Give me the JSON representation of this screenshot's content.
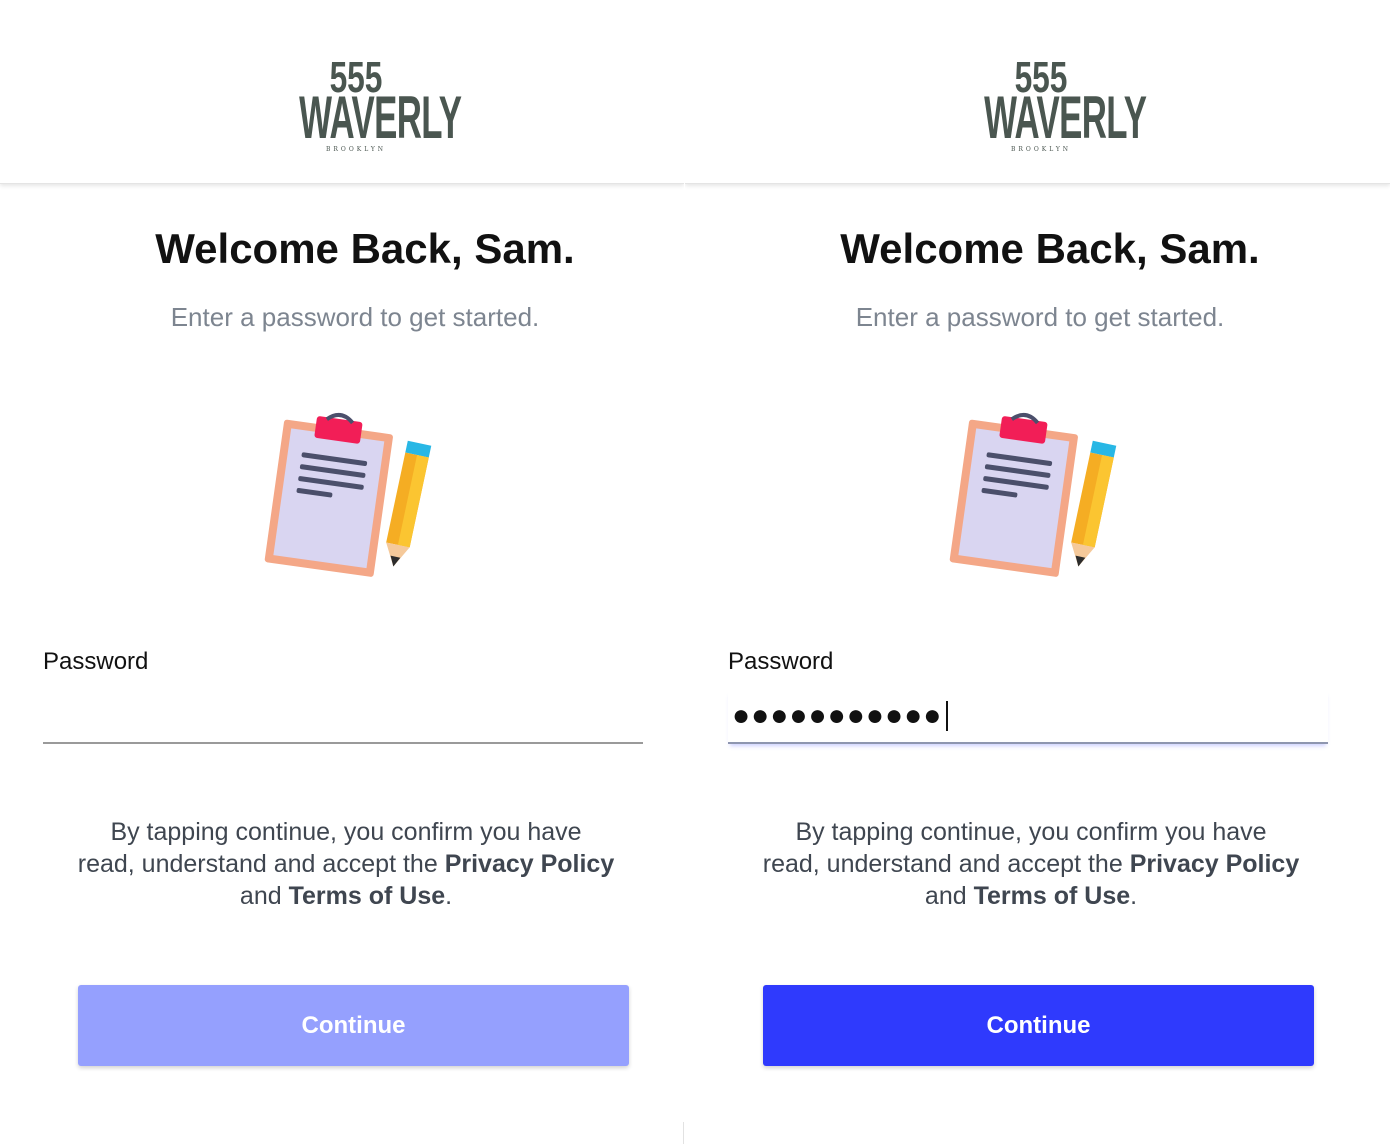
{
  "colors": {
    "logo": "#4a5650",
    "title": "#111111",
    "subtitle": "#7d8590",
    "button_disabled": "#95a0fe",
    "button_enabled": "#2f3afd"
  },
  "screens": [
    {
      "logo": {
        "number": "555",
        "name": "WAVERLY",
        "sub": "BROOKLYN"
      },
      "title": "Welcome Back, Sam.",
      "subtitle": "Enter a password to get started.",
      "illustration_icon": "clipboard-pencil-icon",
      "password": {
        "label": "Password",
        "value": ""
      },
      "terms": {
        "line1": "By tapping continue, you confirm you have",
        "line2_prefix": "read, understand and accept the ",
        "privacy": "Privacy Policy",
        "line3_prefix": "and ",
        "terms_of_use": "Terms of Use",
        "end": "."
      },
      "button": {
        "label": "Continue",
        "state": "disabled"
      }
    },
    {
      "logo": {
        "number": "555",
        "name": "WAVERLY",
        "sub": "BROOKLYN"
      },
      "title": "Welcome Back, Sam.",
      "subtitle": "Enter a password to get started.",
      "illustration_icon": "clipboard-pencil-icon",
      "password": {
        "label": "Password",
        "value": "●●●●●●●●●●●"
      },
      "terms": {
        "line1": "By tapping continue, you confirm you have",
        "line2_prefix": "read, understand and accept the ",
        "privacy": "Privacy Policy",
        "line3_prefix": "and ",
        "terms_of_use": "Terms of Use",
        "end": "."
      },
      "button": {
        "label": "Continue",
        "state": "enabled"
      }
    }
  ]
}
